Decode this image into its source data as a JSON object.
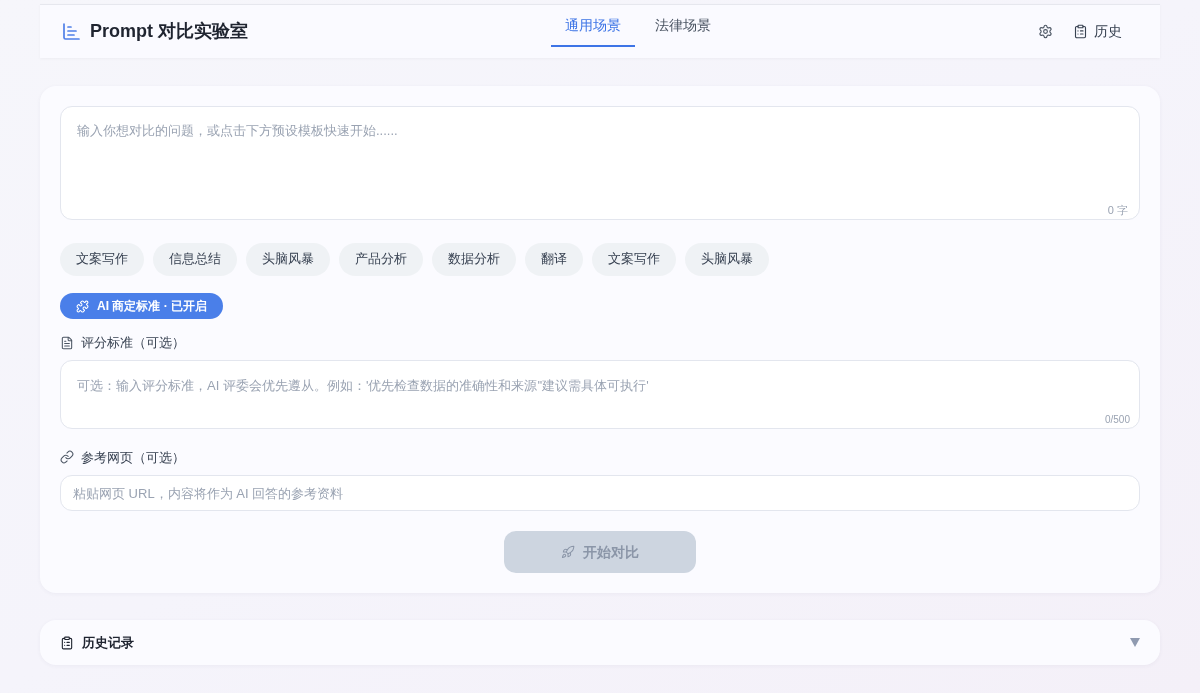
{
  "header": {
    "title": "Prompt 对比实验室",
    "tabs": [
      {
        "label": "通用场景",
        "selected": true
      },
      {
        "label": "法律场景",
        "selected": false
      }
    ],
    "history_button": "历史"
  },
  "question": {
    "placeholder": "输入你想对比的问题，或点击下方预设模板快速开始......",
    "counter": "0 字"
  },
  "templates": [
    "文案写作",
    "信息总结",
    "头脑风暴",
    "产品分析",
    "数据分析",
    "翻译",
    "文案写作",
    "头脑风暴"
  ],
  "ai_criteria_toggle": {
    "label": "AI 商定标准 · 已开启",
    "on": true
  },
  "criteria": {
    "label": "评分标准（可选）",
    "placeholder": "可选：输入评分标准，AI 评委会优先遵从。例如：'优先检查数据的准确性和来源''建议需具体可执行'",
    "counter": "0/500"
  },
  "reference": {
    "label": "参考网页（可选）",
    "placeholder": "粘贴网页 URL，内容将作为 AI 回答的参考资料"
  },
  "start_button": {
    "label": "开始对比",
    "disabled": true
  },
  "history_panel": {
    "title": "历史记录",
    "expanded": false
  }
}
